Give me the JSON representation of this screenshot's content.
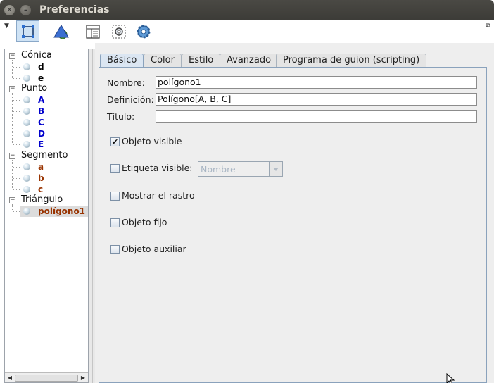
{
  "window": {
    "title": "Preferencias"
  },
  "toolbar": {
    "tools": [
      {
        "name": "object-properties-tool",
        "selected": true
      },
      {
        "name": "graphics-view-tool",
        "selected": false
      },
      {
        "name": "layout-tool",
        "selected": false
      },
      {
        "name": "defaults-tool",
        "selected": false
      },
      {
        "name": "advanced-settings-tool",
        "selected": false
      }
    ]
  },
  "tree": {
    "groups": [
      {
        "label": "Cónica",
        "items": [
          {
            "label": "d",
            "color": "#000000"
          },
          {
            "label": "e",
            "color": "#000000"
          }
        ]
      },
      {
        "label": "Punto",
        "items": [
          {
            "label": "A",
            "color": "#0000cc"
          },
          {
            "label": "B",
            "color": "#0000cc"
          },
          {
            "label": "C",
            "color": "#0000cc"
          },
          {
            "label": "D",
            "color": "#0000cc"
          },
          {
            "label": "E",
            "color": "#0000cc"
          }
        ]
      },
      {
        "label": "Segmento",
        "items": [
          {
            "label": "a",
            "color": "#993300"
          },
          {
            "label": "b",
            "color": "#993300"
          },
          {
            "label": "c",
            "color": "#993300"
          }
        ]
      },
      {
        "label": "Triángulo",
        "items": [
          {
            "label": "polígono1",
            "color": "#993300",
            "selected": true
          }
        ]
      }
    ]
  },
  "tabs": [
    {
      "label": "Básico",
      "active": true
    },
    {
      "label": "Color",
      "active": false
    },
    {
      "label": "Estilo",
      "active": false
    },
    {
      "label": "Avanzado",
      "active": false
    },
    {
      "label": "Programa de guion (scripting)",
      "active": false
    }
  ],
  "basic": {
    "name_label": "Nombre:",
    "name_value": "polígono1",
    "definition_label": "Definición:",
    "definition_value": "Polígono[A, B, C]",
    "caption_label": "Título:",
    "caption_value": "",
    "show_object": {
      "label": "Objeto visible",
      "checked": true
    },
    "show_label": {
      "label": "Etiqueta visible:",
      "checked": false
    },
    "label_mode": {
      "selected": "Nombre"
    },
    "show_trace": {
      "label": "Mostrar el rastro",
      "checked": false
    },
    "fix_object": {
      "label": "Objeto fijo",
      "checked": false
    },
    "auxiliary": {
      "label": "Objeto auxiliar",
      "checked": false
    }
  },
  "colors": {
    "accent": "#dbe6f2",
    "titlebar": "#3c3b37",
    "panel": "#eeeeee"
  }
}
